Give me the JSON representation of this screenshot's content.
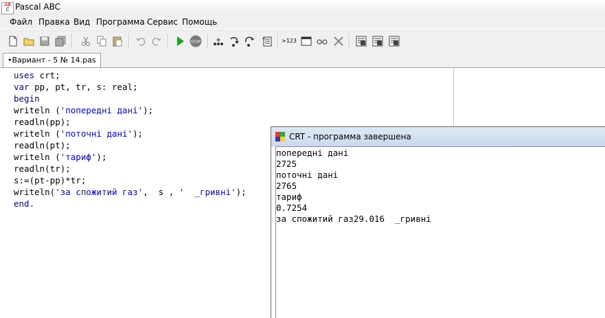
{
  "window": {
    "title": "Pascal ABC",
    "icon": "pascal-abc-icon",
    "icon_letters": [
      "АВ",
      "С"
    ]
  },
  "menu": [
    "Файл",
    "Правка",
    "Вид",
    "Программа",
    "Сервис",
    "Помощь"
  ],
  "toolbar": {
    "buttons": [
      "new",
      "open",
      "save",
      "save-all",
      "cut",
      "copy",
      "paste",
      "undo",
      "redo",
      "run",
      "stop",
      "step-over",
      "step-into",
      "step-out",
      "add-watch",
      "evaluate",
      "window",
      "watch",
      "delete",
      "debug-1",
      "debug-2",
      "debug-3"
    ],
    "stop_label": "STOP",
    "evaluate_label": ">123"
  },
  "tab": {
    "label": "•Вариант - 5 № 14.pas"
  },
  "editor": {
    "lines": [
      [
        {
          "t": "uses",
          "c": "kw"
        },
        {
          "t": " crt;",
          "c": ""
        }
      ],
      [
        {
          "t": "var",
          "c": "kw"
        },
        {
          "t": " pp, pt, tr, s: real;",
          "c": ""
        }
      ],
      [
        {
          "t": "begin",
          "c": "kw"
        }
      ],
      [
        {
          "t": "writeln (",
          "c": ""
        },
        {
          "t": "'попередні дані'",
          "c": "str"
        },
        {
          "t": ");",
          "c": ""
        }
      ],
      [
        {
          "t": "readln(pp);",
          "c": ""
        }
      ],
      [
        {
          "t": "writeln (",
          "c": ""
        },
        {
          "t": "'поточні дані'",
          "c": "str"
        },
        {
          "t": ");",
          "c": ""
        }
      ],
      [
        {
          "t": "readln(pt);",
          "c": ""
        }
      ],
      [
        {
          "t": "writeln (",
          "c": ""
        },
        {
          "t": "'тариф'",
          "c": "str"
        },
        {
          "t": ");",
          "c": ""
        }
      ],
      [
        {
          "t": "readln(tr);",
          "c": ""
        }
      ],
      [
        {
          "t": "s:=(pt-pp)*tr;",
          "c": ""
        }
      ],
      [
        {
          "t": "writeln(",
          "c": ""
        },
        {
          "t": "'за спожитий газ'",
          "c": "str"
        },
        {
          "t": ",  s , ",
          "c": ""
        },
        {
          "t": "'  _гривні'",
          "c": "str"
        },
        {
          "t": ");",
          "c": ""
        }
      ],
      [
        {
          "t": "end.",
          "c": "kw"
        }
      ]
    ]
  },
  "crt": {
    "title": "CRT - программа завершена",
    "output": [
      "попередні дані",
      "2725",
      "поточні дані",
      "2765",
      "тариф",
      "0.7254",
      "за спожитий газ29.016  _гривні"
    ]
  },
  "colors": {
    "keyword": "#0000a0",
    "string": "#0000ff",
    "run_green": "#1fa31f",
    "stop_gray": "#7a7a7a"
  }
}
